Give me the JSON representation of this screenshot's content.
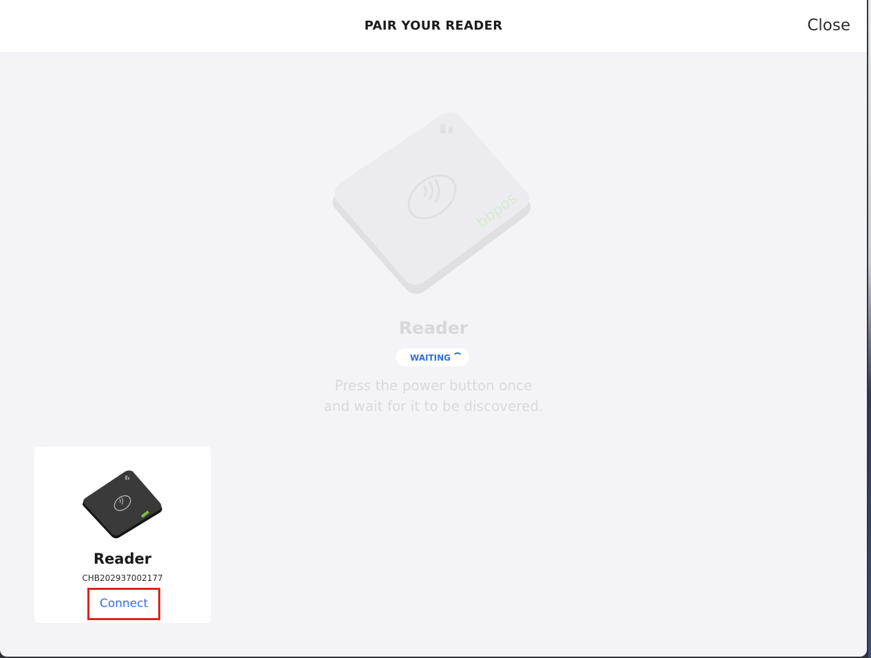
{
  "modal": {
    "title": "PAIR YOUR READER",
    "close_label": "Close"
  },
  "discovery": {
    "device_name": "Reader",
    "status": "WAITING",
    "instructions_line1": "Press the power button once",
    "instructions_line2": "and wait for it to be discovered.",
    "device_icon": "card-reader-icon",
    "device_brand": "bbpos"
  },
  "found_reader": {
    "name": "Reader",
    "serial": "CHB202937002177",
    "connect_label": "Connect",
    "device_icon": "card-reader-icon"
  },
  "colors": {
    "accent": "#2f6fde",
    "highlight": "#e0201b",
    "background": "#f4f4f8"
  }
}
